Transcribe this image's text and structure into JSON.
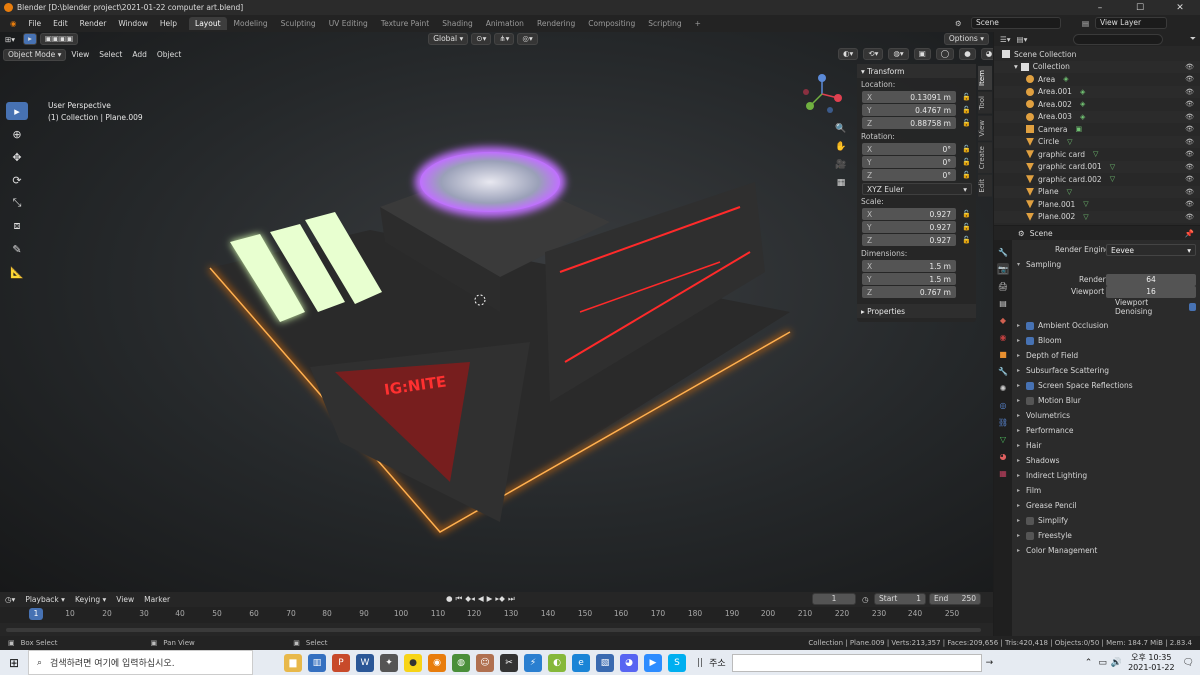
{
  "window": {
    "title": "Blender [D:\\blender project\\2021-01-22 computer art.blend]",
    "controls": [
      "–",
      "☐",
      "✕"
    ]
  },
  "menu": [
    "File",
    "Edit",
    "Render",
    "Window",
    "Help"
  ],
  "workspaces": [
    "Layout",
    "Modeling",
    "Sculpting",
    "UV Editing",
    "Texture Paint",
    "Shading",
    "Animation",
    "Rendering",
    "Compositing",
    "Scripting"
  ],
  "active_workspace": "Layout",
  "scene": {
    "name": "Scene",
    "view_layer": "View Layer"
  },
  "viewport": {
    "mode": "Object Mode",
    "menus": [
      "View",
      "Select",
      "Add",
      "Object"
    ],
    "orientation": "Global",
    "options": "Options",
    "info_line1": "User Perspective",
    "info_line2": "(1) Collection | Plane.009",
    "logo_text": "IG:NITE"
  },
  "npanel": {
    "tabs": [
      "Item",
      "Tool",
      "View",
      "Create",
      "Edit"
    ],
    "transform": "Transform",
    "location_label": "Location:",
    "location": [
      {
        "k": "X",
        "v": "0.13091 m"
      },
      {
        "k": "Y",
        "v": "0.4767 m"
      },
      {
        "k": "Z",
        "v": "0.88758 m"
      }
    ],
    "rotation_label": "Rotation:",
    "rotation": [
      {
        "k": "X",
        "v": "0°"
      },
      {
        "k": "Y",
        "v": "0°"
      },
      {
        "k": "Z",
        "v": "0°"
      }
    ],
    "rotation_mode": "XYZ Euler",
    "scale_label": "Scale:",
    "scale": [
      {
        "k": "X",
        "v": "0.927"
      },
      {
        "k": "Y",
        "v": "0.927"
      },
      {
        "k": "Z",
        "v": "0.927"
      }
    ],
    "dimensions_label": "Dimensions:",
    "dimensions": [
      {
        "k": "X",
        "v": "1.5 m"
      },
      {
        "k": "Y",
        "v": "1.5 m"
      },
      {
        "k": "Z",
        "v": "0.767 m"
      }
    ],
    "properties": "Properties"
  },
  "outliner": {
    "root": "Scene Collection",
    "collection": "Collection",
    "items": [
      {
        "name": "Area",
        "color": "#e0a040"
      },
      {
        "name": "Area.001",
        "color": "#e0a040"
      },
      {
        "name": "Area.002",
        "color": "#e0a040"
      },
      {
        "name": "Area.003",
        "color": "#e0a040"
      },
      {
        "name": "Camera",
        "color": "#e0a040"
      },
      {
        "name": "Circle",
        "color": "#e0a040"
      },
      {
        "name": "graphic card",
        "color": "#e0a040"
      },
      {
        "name": "graphic card.001",
        "color": "#e0a040"
      },
      {
        "name": "graphic card.002",
        "color": "#e0a040"
      },
      {
        "name": "Plane",
        "color": "#e0a040"
      },
      {
        "name": "Plane.001",
        "color": "#e0a040"
      },
      {
        "name": "Plane.002",
        "color": "#e0a040"
      }
    ]
  },
  "properties": {
    "context": "Scene",
    "render_engine_label": "Render Engine",
    "render_engine": "Eevee",
    "sampling": "Sampling",
    "render_label": "Render",
    "render_samples": "64",
    "viewport_label": "Viewport",
    "viewport_samples": "16",
    "viewport_denoising": "Viewport Denoising",
    "panels": [
      {
        "label": "Ambient Occlusion",
        "check": true
      },
      {
        "label": "Bloom",
        "check": true
      },
      {
        "label": "Depth of Field",
        "check": null
      },
      {
        "label": "Subsurface Scattering",
        "check": null
      },
      {
        "label": "Screen Space Reflections",
        "check": true
      },
      {
        "label": "Motion Blur",
        "check": false
      },
      {
        "label": "Volumetrics",
        "check": null
      },
      {
        "label": "Performance",
        "check": null
      },
      {
        "label": "Hair",
        "check": null
      },
      {
        "label": "Shadows",
        "check": null
      },
      {
        "label": "Indirect Lighting",
        "check": null
      },
      {
        "label": "Film",
        "check": null
      },
      {
        "label": "Grease Pencil",
        "check": null
      },
      {
        "label": "Simplify",
        "check": false
      },
      {
        "label": "Freestyle",
        "check": false
      },
      {
        "label": "Color Management",
        "check": null
      }
    ]
  },
  "timeline": {
    "menus": [
      "Playback",
      "Keying",
      "View",
      "Marker"
    ],
    "current_frame": "1",
    "start_label": "Start",
    "start": "1",
    "end_label": "End",
    "end": "250",
    "ticks": [
      "10",
      "20",
      "30",
      "40",
      "50",
      "60",
      "70",
      "80",
      "90",
      "100",
      "110",
      "120",
      "130",
      "140",
      "150",
      "160",
      "170",
      "180",
      "190",
      "200",
      "210",
      "220",
      "230",
      "240",
      "250"
    ]
  },
  "status": {
    "left1": "Box Select",
    "left2": "Pan View",
    "left3": "Select",
    "stats": "Collection | Plane.009 | Verts:213,357 | Faces:209,656 | Tris:420,418 | Objects:0/50 | Mem: 184.7 MiB | 2.83.4"
  },
  "taskbar": {
    "search_placeholder": "검색하려면 여기에 입력하십시오.",
    "address_label": "주소",
    "time": "오후 10:35",
    "date": "2021-01-22"
  }
}
